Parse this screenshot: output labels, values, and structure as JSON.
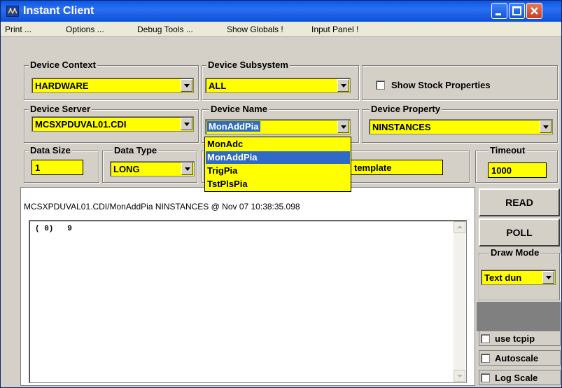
{
  "window": {
    "title": "Instant Client"
  },
  "menu": [
    "Print ...",
    "Options ...",
    "Debug Tools ...",
    "Show Globals !",
    "Input Panel !"
  ],
  "device_context": {
    "label": "Device Context",
    "value": "HARDWARE"
  },
  "device_subsystem": {
    "label": "Device Subsystem",
    "value": "ALL"
  },
  "show_stock_properties": {
    "label": "Show Stock Properties",
    "checked": false
  },
  "device_server": {
    "label": "Device Server",
    "value": "MCSXPDUVAL01.CDI"
  },
  "device_name": {
    "label": "Device Name",
    "value": "MonAddPia",
    "options": [
      "MonAdc",
      "MonAddPia",
      "TrigPia",
      "TstPlsPia"
    ],
    "selected_index": 1
  },
  "device_property": {
    "label": "Device Property",
    "value": "NINSTANCES"
  },
  "data_size": {
    "label": "Data Size",
    "value": "1"
  },
  "data_type": {
    "label": "Data Type",
    "value": "LONG"
  },
  "template_field": {
    "value": "template"
  },
  "timeout": {
    "label": "Timeout",
    "value": "1000"
  },
  "output": {
    "info_line": "MCSXPDUVAL01.CDI/MonAddPia NINSTANCES @ Nov 07 10:38:35.098",
    "text": "( 0)   9"
  },
  "buttons": {
    "read": "READ",
    "poll": "POLL"
  },
  "draw_mode": {
    "label": "Draw Mode",
    "value": "Text dun"
  },
  "options": [
    {
      "label": "use tcpip",
      "checked": false
    },
    {
      "label": "Autoscale",
      "checked": false
    },
    {
      "label": "Log Scale",
      "checked": false
    }
  ],
  "colors": {
    "field_bg": "#ffff00",
    "titlebar": "#0a58e8",
    "selection": "#316ac5"
  }
}
